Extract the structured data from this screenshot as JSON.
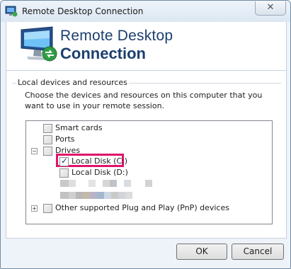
{
  "window": {
    "title": "Remote Desktop Connection",
    "close_glyph": "✕"
  },
  "banner": {
    "line1": "Remote Desktop",
    "line2": "Connection",
    "icon": "remote-desktop-monitor-icon"
  },
  "group": {
    "title": "Local devices and resources",
    "description": "Choose the devices and resources on this computer that you want to use in your remote session."
  },
  "tree": {
    "smart_cards": {
      "label": "Smart cards",
      "checked": false
    },
    "ports": {
      "label": "Ports",
      "checked": false
    },
    "drives": {
      "label": "Drives",
      "checked": false,
      "expander": "−"
    },
    "local_disk_c": {
      "label": "Local Disk (C:)",
      "checked": true
    },
    "local_disk_d": {
      "label": "Local Disk (D:)",
      "checked": false
    },
    "other_devices": {
      "label": "Other supported Plug and Play (PnP) devices",
      "checked": false,
      "expander": "+"
    }
  },
  "buttons": {
    "ok": "OK",
    "cancel": "Cancel"
  },
  "colors": {
    "highlight": "#e0146a",
    "banner_text": "#1c3f6e"
  }
}
